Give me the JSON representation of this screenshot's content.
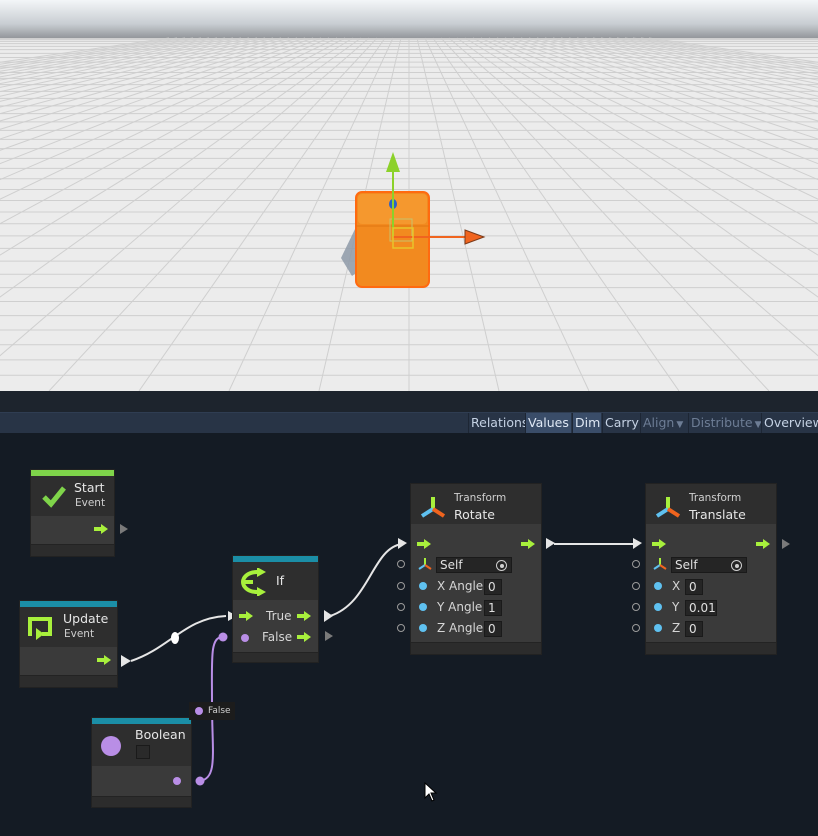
{
  "toolbar": {
    "buttons": [
      {
        "label": "Relations",
        "state": "normal"
      },
      {
        "label": "Values",
        "state": "active"
      },
      {
        "label": "Dim",
        "state": "active"
      },
      {
        "label": "Carry",
        "state": "normal"
      },
      {
        "label": "Align",
        "state": "disabled",
        "dropdown": true
      },
      {
        "label": "Distribute",
        "state": "disabled",
        "dropdown": true
      },
      {
        "label": "Overview",
        "state": "normal"
      }
    ]
  },
  "nodes": {
    "start": {
      "title": "Start",
      "subtitle": "Event",
      "icon": "check-icon",
      "color": "#7fd44a"
    },
    "update": {
      "title": "Update",
      "subtitle": "Event",
      "icon": "loop-icon",
      "color": "#1b8ea6"
    },
    "if": {
      "title": "If",
      "icon": "branch-icon",
      "color": "#1b8ea6",
      "ports": {
        "true": "True",
        "false": "False"
      }
    },
    "rotate": {
      "category": "Transform",
      "title": "Rotate",
      "icon": "transform-icon",
      "target": "Self",
      "inputs": [
        {
          "label": "X Angle",
          "value": "0"
        },
        {
          "label": "Y Angle",
          "value": "1"
        },
        {
          "label": "Z Angle",
          "value": "0"
        }
      ]
    },
    "translate": {
      "category": "Transform",
      "title": "Translate",
      "icon": "transform-icon",
      "target": "Self",
      "inputs": [
        {
          "label": "X",
          "value": "0"
        },
        {
          "label": "Y",
          "value": "0.01"
        },
        {
          "label": "Z",
          "value": "0"
        }
      ]
    },
    "boolean": {
      "title": "Boolean",
      "icon": "circle-icon",
      "color": "#1b8ea6",
      "checked": false
    }
  },
  "tooltip": {
    "text": "False"
  },
  "colors": {
    "flow": "#a8f03c",
    "data_blue": "#5fc1f0",
    "data_purple": "#b98ee6",
    "cube": "#f28a1f",
    "header_teal": "#1b8ea6"
  }
}
